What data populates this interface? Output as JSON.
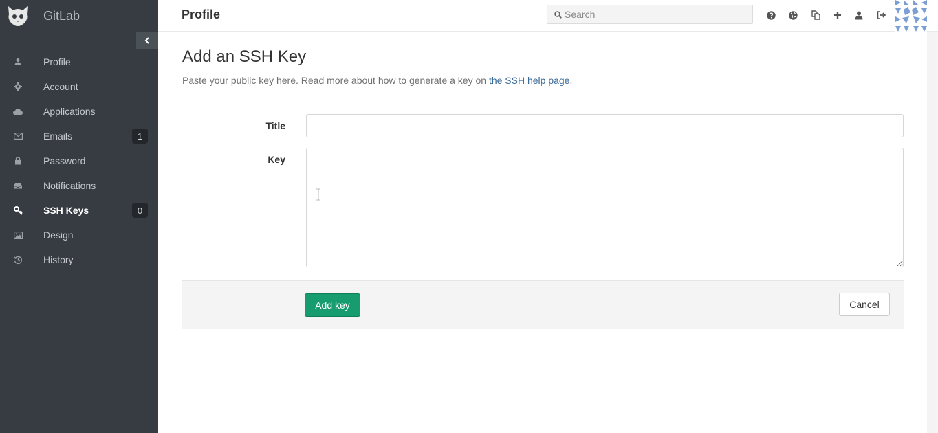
{
  "app": {
    "name": "GitLab"
  },
  "sidebar": {
    "items": [
      {
        "label": "Profile",
        "icon": "user-icon",
        "badge": null,
        "active": false
      },
      {
        "label": "Account",
        "icon": "gear-icon",
        "badge": null,
        "active": false
      },
      {
        "label": "Applications",
        "icon": "cloud-icon",
        "badge": null,
        "active": false
      },
      {
        "label": "Emails",
        "icon": "envelope-icon",
        "badge": "1",
        "active": false
      },
      {
        "label": "Password",
        "icon": "lock-icon",
        "badge": null,
        "active": false
      },
      {
        "label": "Notifications",
        "icon": "inbox-icon",
        "badge": null,
        "active": false
      },
      {
        "label": "SSH Keys",
        "icon": "key-icon",
        "badge": "0",
        "active": true
      },
      {
        "label": "Design",
        "icon": "image-icon",
        "badge": null,
        "active": false
      },
      {
        "label": "History",
        "icon": "history-icon",
        "badge": null,
        "active": false
      }
    ]
  },
  "header": {
    "title": "Profile",
    "search_placeholder": "Search",
    "icons": [
      "help-icon",
      "globe-icon",
      "copy-icon",
      "plus-icon",
      "user-icon",
      "sign-out-icon"
    ]
  },
  "main": {
    "heading": "Add an SSH Key",
    "lead_prefix": "Paste your public key here. Read more about how to generate a key on ",
    "lead_link": "the SSH help page",
    "lead_suffix": ".",
    "form": {
      "title_label": "Title",
      "title_value": "",
      "key_label": "Key",
      "key_value": ""
    },
    "actions": {
      "submit_label": "Add key",
      "cancel_label": "Cancel"
    }
  },
  "colors": {
    "sidebar_bg": "#363c42",
    "accent_green": "#169c6e",
    "link": "#3a6b9a"
  }
}
